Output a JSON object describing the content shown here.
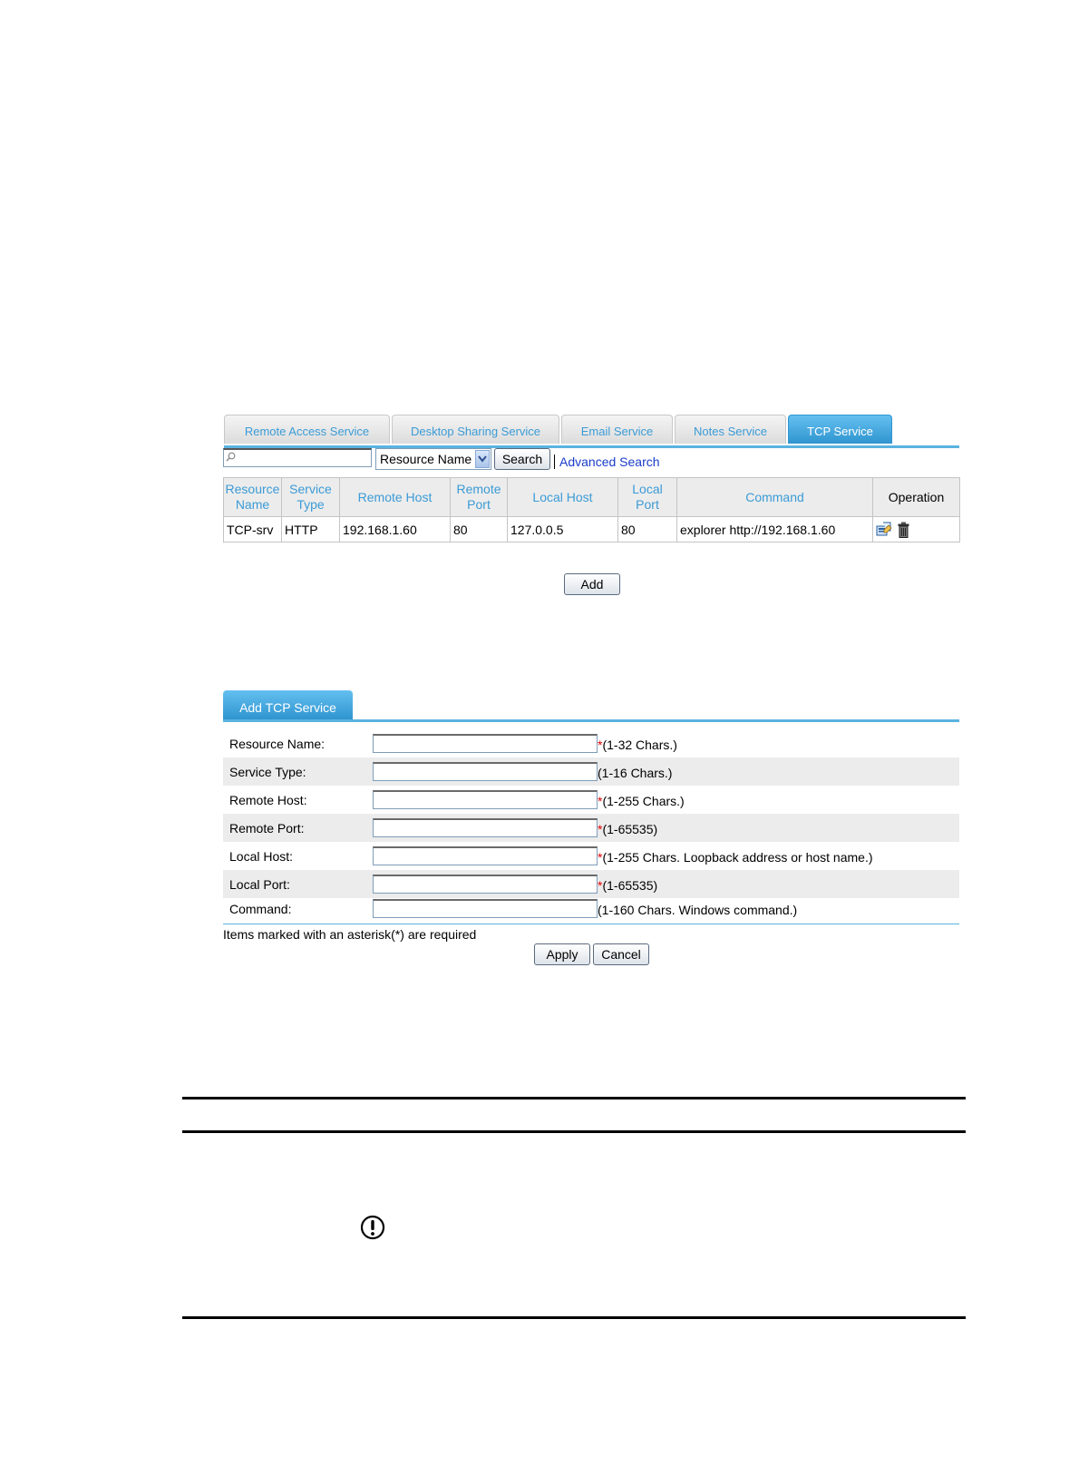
{
  "tabs": [
    {
      "label": "Remote Access Service",
      "active": false
    },
    {
      "label": "Desktop Sharing Service",
      "active": false
    },
    {
      "label": "Email Service",
      "active": false
    },
    {
      "label": "Notes Service",
      "active": false
    },
    {
      "label": "TCP Service",
      "active": true
    }
  ],
  "search": {
    "value": "",
    "field_select": "Resource Name",
    "button": "Search",
    "advanced_link": "Advanced Search"
  },
  "table": {
    "headers": {
      "resource_name": [
        "Resource",
        "Name"
      ],
      "service_type": [
        "Service",
        "Type"
      ],
      "remote_host": "Remote Host",
      "remote_port": [
        "Remote",
        "Port"
      ],
      "local_host": "Local Host",
      "local_port": [
        "Local",
        "Port"
      ],
      "command": "Command",
      "operation": "Operation"
    },
    "rows": [
      {
        "resource_name": "TCP-srv",
        "service_type": "HTTP",
        "remote_host": "192.168.1.60",
        "remote_port": "80",
        "local_host": "127.0.0.5",
        "local_port": "80",
        "command": "explorer http://192.168.1.60",
        "operation_icons": [
          "edit-icon",
          "delete-icon"
        ]
      }
    ]
  },
  "add_button": "Add",
  "form": {
    "tab": "Add TCP Service",
    "fields": [
      {
        "label": "Resource Name:",
        "value": "",
        "required": true,
        "hint": "(1-32 Chars.)"
      },
      {
        "label": "Service Type:",
        "value": "",
        "required": false,
        "hint": "(1-16 Chars.)"
      },
      {
        "label": "Remote Host:",
        "value": "",
        "required": true,
        "hint": "(1-255 Chars.)"
      },
      {
        "label": "Remote Port:",
        "value": "",
        "required": true,
        "hint": "(1-65535)"
      },
      {
        "label": "Local Host:",
        "value": "",
        "required": true,
        "hint": "(1-255 Chars. Loopback address or host name.)"
      },
      {
        "label": "Local Port:",
        "value": "",
        "required": true,
        "hint": "(1-65535)"
      },
      {
        "label": "Command:",
        "value": "",
        "required": false,
        "hint": "(1-160 Chars. Windows command.)"
      }
    ],
    "required_note": "Items marked with an asterisk(*) are required",
    "apply": "Apply",
    "cancel": "Cancel",
    "asterisk": "*"
  },
  "colors": {
    "accent": "#5ab3e0",
    "tab_active": "#2f95cf",
    "link": "#1a3cc8",
    "header_text": "#3b9bd6",
    "required": "#e00000"
  }
}
